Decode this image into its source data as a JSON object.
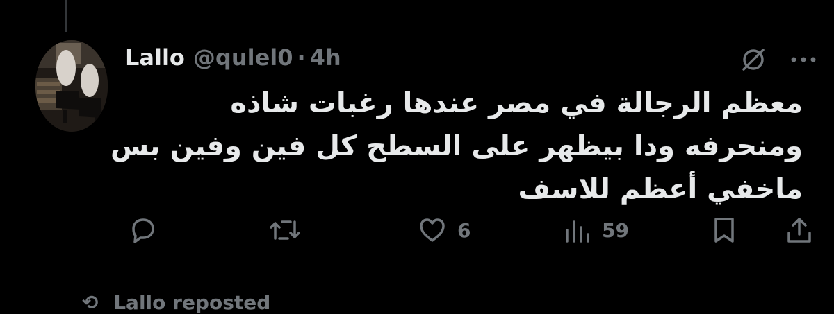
{
  "tweet": {
    "display_name": "Lallo",
    "handle": "@qulel0",
    "separator": "·",
    "time": "4h",
    "text": "معظم الرجالة في مصر عندها رغبات شاذه\nومنحرفه ودا بيظهر على السطح كل فين وفين بس\nماخفي أعظم للاسف"
  },
  "actions": {
    "like_count": "6",
    "view_count": "59"
  },
  "next_item": {
    "text": "Lallo reposted"
  },
  "icons": {
    "header": [
      "grok-icon",
      "more-icon"
    ],
    "actions": [
      "reply-icon",
      "repost-icon",
      "like-icon",
      "views-icon",
      "bookmark-icon",
      "share-icon"
    ]
  },
  "colors": {
    "background": "#000000",
    "primary_text": "#e7e9ea",
    "secondary_text": "#71767b"
  }
}
